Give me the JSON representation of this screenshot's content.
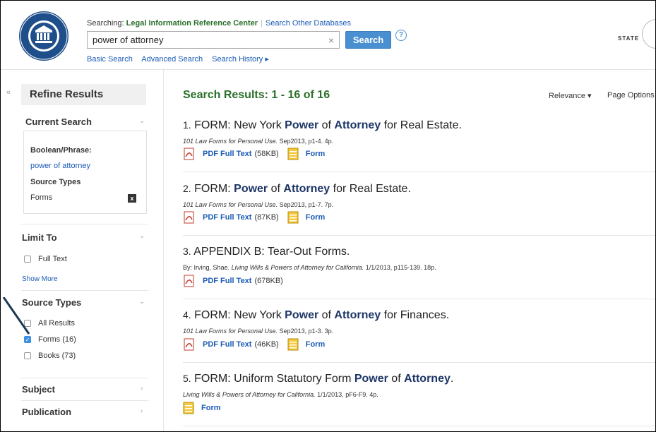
{
  "header": {
    "searching_prefix": "Searching:",
    "database": "Legal Information Reference Center",
    "other_databases": "Search Other Databases",
    "query": "power of attorney",
    "clear": "×",
    "search_button": "Search",
    "help": "?",
    "links": [
      "Basic Search",
      "Advanced Search",
      "Search History ▸"
    ],
    "state_text": "STATE"
  },
  "sidebar": {
    "collapse": "«",
    "refine_title": "Refine Results",
    "current_search": {
      "title": "Current Search",
      "boolean_label": "Boolean/Phrase:",
      "boolean_value": "power of attorney",
      "source_label": "Source Types",
      "source_value": "Forms",
      "remove": "x"
    },
    "limit_to": {
      "title": "Limit To",
      "full_text": "Full Text",
      "show_more": "Show More"
    },
    "source_types": {
      "title": "Source Types",
      "options": [
        {
          "label": "All Results",
          "checked": false
        },
        {
          "label": "Forms (16)",
          "checked": true
        },
        {
          "label": "Books (73)",
          "checked": false
        }
      ]
    },
    "subject": "Subject",
    "publication": "Publication"
  },
  "results": {
    "title": "Search Results: 1 - 16 of 16",
    "sort": "Relevance ▾",
    "page_options": "Page Options",
    "items": [
      {
        "num": "1.",
        "parts": [
          "FORM: New York ",
          "Power",
          " of ",
          "Attorney",
          " for Real Estate."
        ],
        "source_italic": "101 Law Forms for Personal Use.",
        "source_rest": " Sep2013, p1-4. 4p.",
        "pdf_label": "PDF Full Text",
        "pdf_size": "(58KB)",
        "form_label": "Form"
      },
      {
        "num": "2.",
        "parts": [
          "FORM: ",
          "Power",
          " of ",
          "Attorney",
          " for Real Estate."
        ],
        "source_italic": "101 Law Forms for Personal Use.",
        "source_rest": " Sep2013, p1-7. 7p.",
        "pdf_label": "PDF Full Text",
        "pdf_size": "(87KB)",
        "form_label": "Form"
      },
      {
        "num": "3.",
        "title": "APPENDIX B: Tear-Out Forms.",
        "source_prefix": "By: Irving, Shae.",
        "source_italic": "Living Wills & Powers of Attorney for California.",
        "source_rest": " 1/1/2013, p115-139. 18p.",
        "pdf_label": "PDF Full Text",
        "pdf_size": "(678KB)"
      },
      {
        "num": "4.",
        "parts": [
          "FORM: New York ",
          "Power",
          " of ",
          "Attorney",
          " for Finances."
        ],
        "source_italic": "101 Law Forms for Personal Use.",
        "source_rest": " Sep2013, p1-3. 3p.",
        "pdf_label": "PDF Full Text",
        "pdf_size": "(46KB)",
        "form_label": "Form"
      },
      {
        "num": "5.",
        "parts": [
          "FORM: Uniform Statutory Form ",
          "Power",
          " of ",
          "Attorney",
          "."
        ],
        "source_italic": "Living Wills & Powers of Attorney for California.",
        "source_rest": " 1/1/2013, pF6-F9. 4p.",
        "form_label": "Form"
      }
    ]
  }
}
